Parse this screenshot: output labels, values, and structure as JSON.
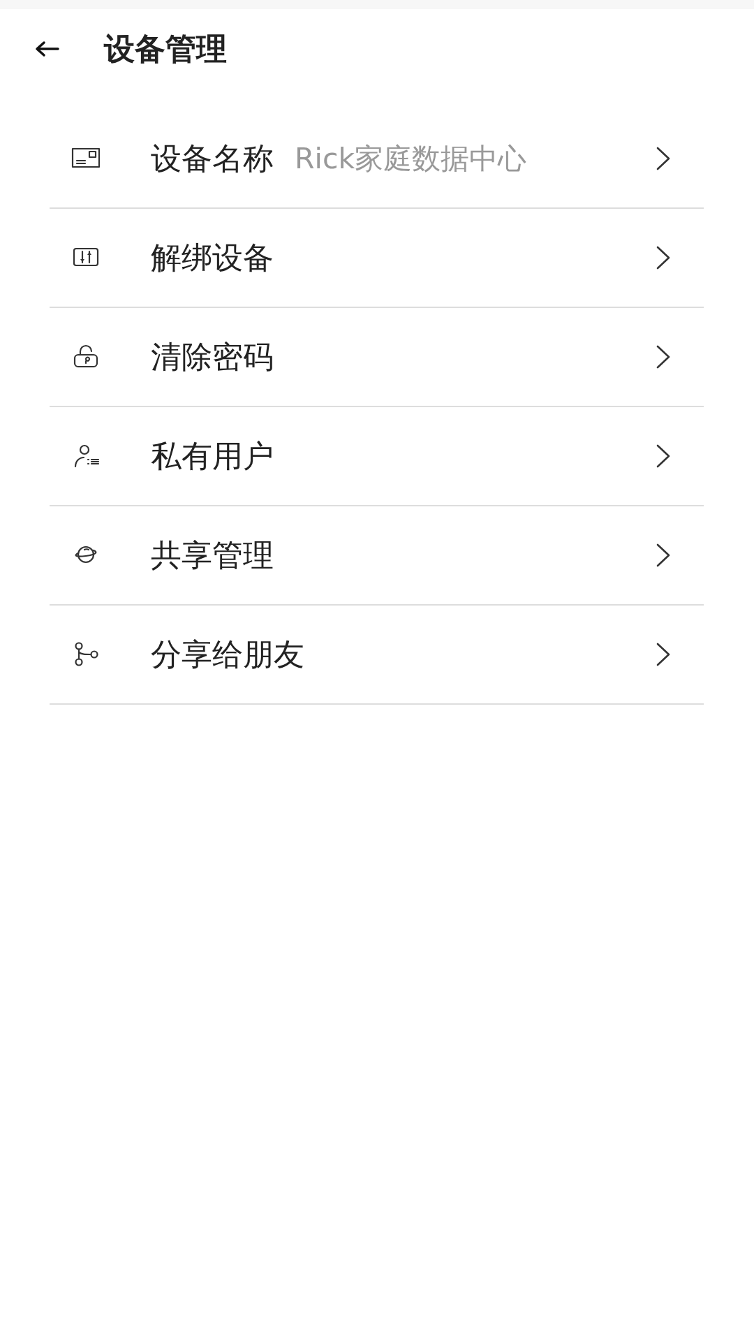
{
  "header": {
    "title": "设备管理"
  },
  "items": [
    {
      "label": "设备名称",
      "value": "Rick家庭数据中心"
    },
    {
      "label": "解绑设备"
    },
    {
      "label": "清除密码"
    },
    {
      "label": "私有用户"
    },
    {
      "label": "共享管理"
    },
    {
      "label": "分享给朋友"
    }
  ]
}
